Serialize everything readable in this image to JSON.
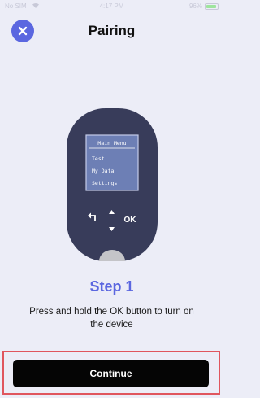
{
  "status_bar": {
    "carrier": "No SIM",
    "time": "4:17 PM",
    "battery_pct": "96%",
    "battery_level": 0.96
  },
  "header": {
    "title": "Pairing",
    "close_icon": "close-x-icon"
  },
  "device": {
    "screen_menu": {
      "title": "Main Menu",
      "items": [
        "Test",
        "My Data",
        "Settings"
      ]
    },
    "ok_label": "OK",
    "back_icon": "back-arrow-icon",
    "up_icon": "triangle-up-icon",
    "down_icon": "triangle-down-icon"
  },
  "step": {
    "title": "Step 1",
    "description": "Press and hold the OK button to turn on the device"
  },
  "actions": {
    "continue_label": "Continue"
  },
  "colors": {
    "accent": "#5b67e0",
    "background": "#ecedf7",
    "device_body": "#383c5a",
    "device_screen": "#6d7fb5",
    "button_bg": "#050505",
    "highlight": "#e0565e"
  }
}
